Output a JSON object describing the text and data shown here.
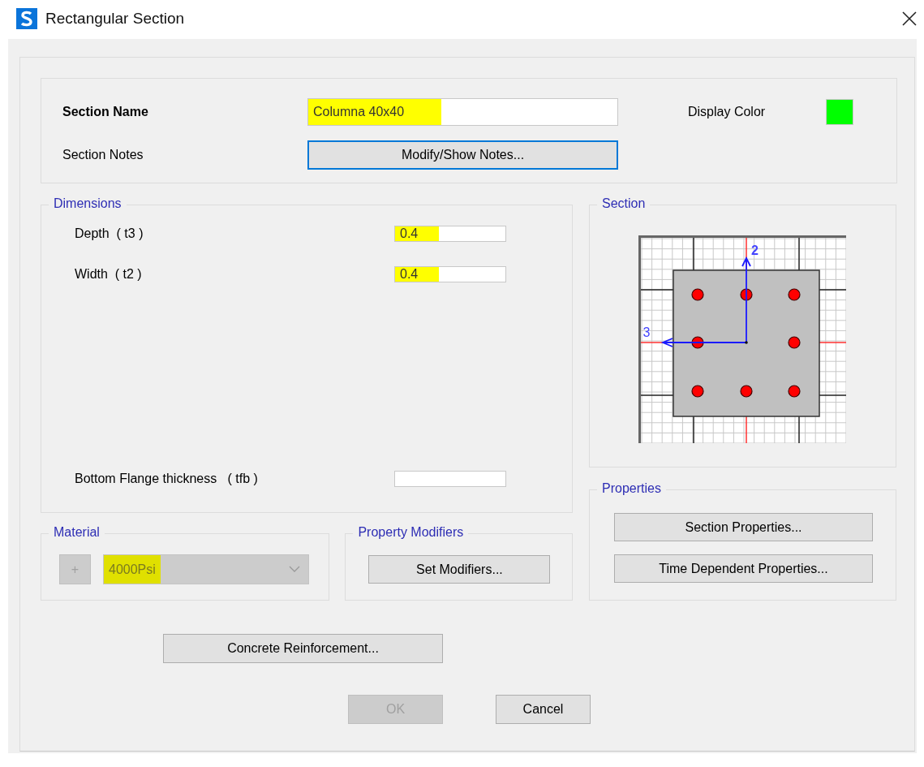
{
  "window": {
    "title": "Rectangular Section"
  },
  "general": {
    "name_label": "Section Name",
    "name_field": {
      "value": "Columna 40x40",
      "highlighted": true
    },
    "display_color": {
      "label": "Display Color",
      "color": "#00ff00"
    },
    "notes_label": "Section Notes",
    "notes_button": {
      "label": "Modify/Show Notes...",
      "focused": true
    }
  },
  "dimensions": {
    "title": "Dimensions",
    "fields": [
      {
        "label": "Depth  ( t3 )",
        "value": "0.4",
        "highlighted": true
      },
      {
        "label": "Width  ( t2 )",
        "value": "0.4",
        "highlighted": true
      },
      {
        "label": "Bottom Flange thickness   ( tfb )",
        "highlighted": false
      }
    ]
  },
  "section": {
    "title": "Section",
    "axis_labels": [
      "2",
      "3"
    ]
  },
  "properties": {
    "title": "Properties",
    "buttons": [
      "Section Properties...",
      "Time Dependent Properties..."
    ]
  },
  "material": {
    "title": "Material",
    "add_button": "+",
    "value": "4000Psi",
    "highlighted": true,
    "disabled": true
  },
  "property_modifiers": {
    "title": "Property Modifiers",
    "button": "Set Modifiers..."
  },
  "concrete_button": "Concrete Reinforcement...",
  "buttons": [
    {
      "label": "OK",
      "disabled": true
    },
    {
      "label": "Cancel",
      "disabled": false
    }
  ]
}
